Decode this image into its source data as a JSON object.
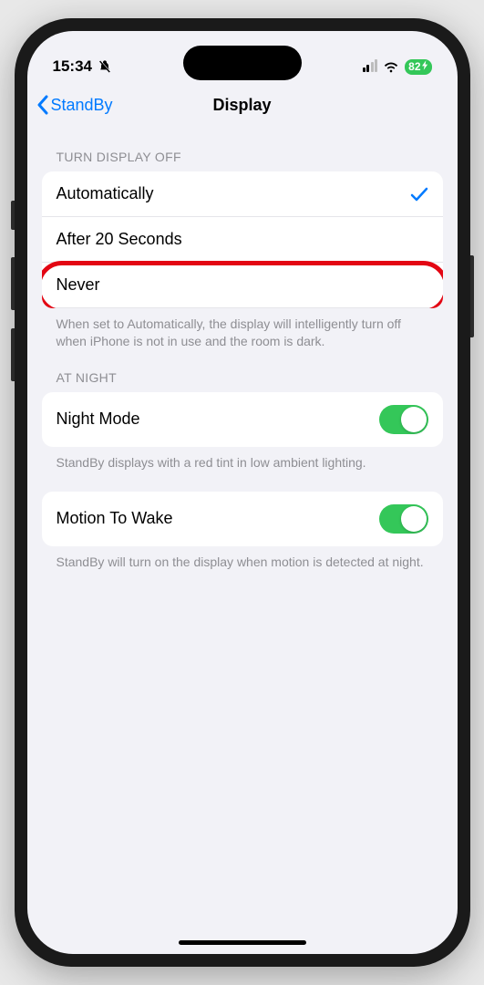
{
  "status": {
    "time": "15:34",
    "battery_pct": "82"
  },
  "nav": {
    "back_label": "StandBy",
    "title": "Display"
  },
  "sections": {
    "turn_off": {
      "header": "TURN DISPLAY OFF",
      "options": {
        "auto": "Automatically",
        "after20": "After 20 Seconds",
        "never": "Never"
      },
      "footer": "When set to Automatically, the display will intelligently turn off when iPhone is not in use and the room is dark."
    },
    "at_night": {
      "header": "AT NIGHT",
      "night_mode_label": "Night Mode",
      "night_mode_footer": "StandBy displays with a red tint in low ambient lighting."
    },
    "motion": {
      "label": "Motion To Wake",
      "footer": "StandBy will turn on the display when motion is detected at night."
    }
  }
}
